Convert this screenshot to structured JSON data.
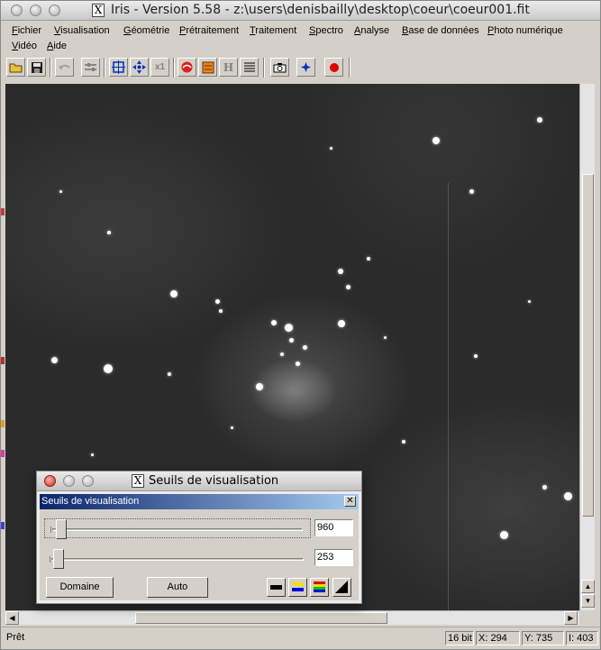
{
  "window": {
    "title": "Iris - Version 5.58 - z:\\users\\denisbailly\\desktop\\coeur\\coeur001.fit",
    "x_logo": "X"
  },
  "menu": [
    "Fichier",
    "Visualisation",
    "Géométrie",
    "Prétraitement",
    "Traitement",
    "Spectro",
    "Analyse",
    "Base de données",
    "Photo numérique",
    "Vidéo",
    "Aide"
  ],
  "toolbar": {
    "text_buttons": {
      "x1": "x1",
      "h": "H"
    }
  },
  "statusbar": {
    "message": "Prêt",
    "bits": "16 bit",
    "x": "X: 294",
    "y": "Y: 735",
    "i": "I: 403"
  },
  "dialog": {
    "window_title": "Seuils de visualisation",
    "caption": "Seuils de visualisation",
    "close": "✕",
    "high_value": "960",
    "low_value": "253",
    "domaine_label": "Domaine",
    "auto_label": "Auto"
  },
  "colors": {
    "caption_start": "#0a246a",
    "caption_end": "#a6caf0",
    "record_red": "#e00000",
    "tool_blue": "#0030c0"
  }
}
